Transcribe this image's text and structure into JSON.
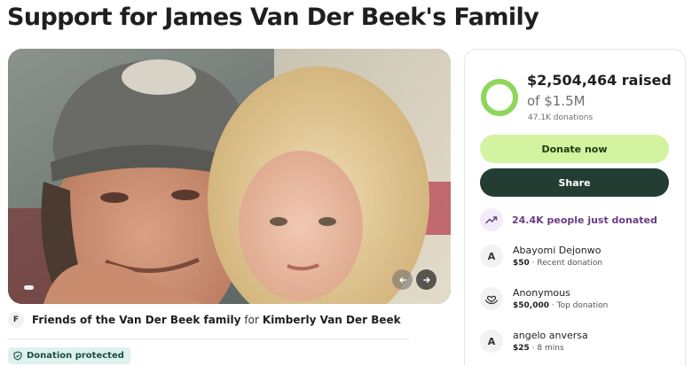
{
  "page": {
    "title": "Support for James Van Der Beek's Family"
  },
  "carousel": {
    "active_index": 0,
    "count": 1
  },
  "organizer": {
    "avatar_initial": "F",
    "name": "Friends of the Van Der Beek family",
    "for_text": "for",
    "beneficiary": "Kimberly Van Der Beek"
  },
  "badge": {
    "label": "Donation protected"
  },
  "stats": {
    "raised": "$2,504,464 raised",
    "goal": "of $1.5M",
    "donations": "47.1K donations",
    "progress_fraction": 1.0
  },
  "actions": {
    "donate_label": "Donate now",
    "share_label": "Share"
  },
  "trend": {
    "text": "24.4K people just donated"
  },
  "donors": [
    {
      "avatar": "A",
      "name": "Abayomi Dejonwo",
      "amount": "$50",
      "note": "· Recent donation"
    },
    {
      "avatar": "heart-hands-icon",
      "name": "Anonymous",
      "amount": "$50,000",
      "note": "· Top donation"
    },
    {
      "avatar": "A",
      "name": "angelo anversa",
      "amount": "$25",
      "note": "· 8 mins"
    }
  ],
  "colors": {
    "donate_bg": "#d3f3a0",
    "share_bg": "#233d33",
    "progress": "#8fd65a",
    "trend_text": "#6c3d87",
    "badge_bg": "#dff1ee"
  }
}
